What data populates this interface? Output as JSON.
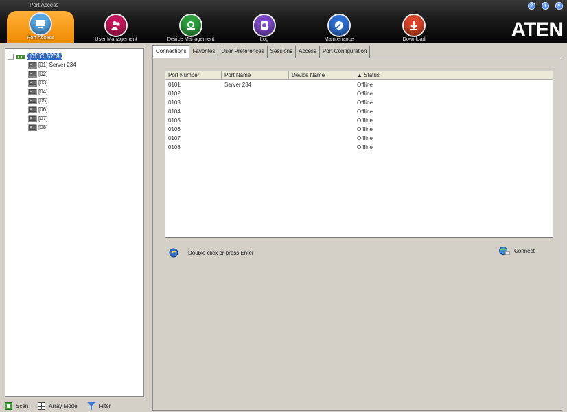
{
  "app": {
    "title": "Port Access",
    "brand": "ATEN"
  },
  "nav": [
    {
      "label": "Port Access",
      "icon": "port-access-icon",
      "color": "#5aa9e6"
    },
    {
      "label": "User Management",
      "icon": "user-management-icon",
      "color": "#c2185b"
    },
    {
      "label": "Device Management",
      "icon": "device-management-icon",
      "color": "#2e9e3e"
    },
    {
      "label": "Log",
      "icon": "log-icon",
      "color": "#7b4bc4"
    },
    {
      "label": "Maintenance",
      "icon": "maintenance-icon",
      "color": "#2f6fd0"
    },
    {
      "label": "Download",
      "icon": "download-icon",
      "color": "#d8442b"
    }
  ],
  "tree": {
    "root": "[01] CL5708",
    "ports": [
      "[01] Server 234",
      "[02]",
      "[03]",
      "[04]",
      "[05]",
      "[06]",
      "[07]",
      "[08]"
    ]
  },
  "bottom": {
    "scan": "Scan",
    "array_mode": "Array Mode",
    "filter": "Filter"
  },
  "tabs": [
    "Connections",
    "Favorites",
    "User Preferences",
    "Sessions",
    "Access",
    "Port Configuration"
  ],
  "grid": {
    "headers": [
      "Port Number",
      "Port Name",
      "Device Name",
      "Status"
    ],
    "sort_indicator": "▲",
    "rows": [
      [
        "0101",
        "Server 234",
        "",
        "Offline"
      ],
      [
        "0102",
        "",
        "",
        "Offline"
      ],
      [
        "0103",
        "",
        "",
        "Offline"
      ],
      [
        "0104",
        "",
        "",
        "Offline"
      ],
      [
        "0105",
        "",
        "",
        "Offline"
      ],
      [
        "0106",
        "",
        "",
        "Offline"
      ],
      [
        "0107",
        "",
        "",
        "Offline"
      ],
      [
        "0108",
        "",
        "",
        "Offline"
      ]
    ]
  },
  "hint": "Double click or press Enter",
  "connect_label": "Connect",
  "colors": {
    "accent": "#f59a12",
    "selection": "#316ac5"
  }
}
